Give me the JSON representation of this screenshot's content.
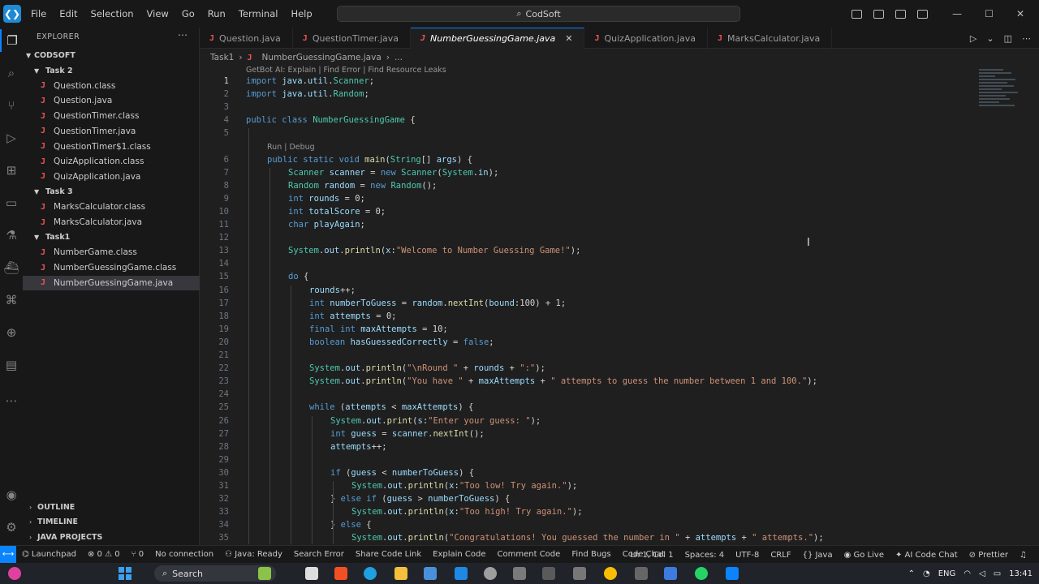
{
  "menu": [
    "File",
    "Edit",
    "Selection",
    "View",
    "Go",
    "Run",
    "Terminal",
    "Help"
  ],
  "search": {
    "text": "CodSoft"
  },
  "explorer": {
    "title": "EXPLORER",
    "root": "CODSOFT",
    "items": [
      {
        "label": "Task 2",
        "kind": "folder",
        "depth": 1
      },
      {
        "label": "Question.class",
        "kind": "class",
        "depth": 2
      },
      {
        "label": "Question.java",
        "kind": "java",
        "depth": 2
      },
      {
        "label": "QuestionTimer.class",
        "kind": "class",
        "depth": 2
      },
      {
        "label": "QuestionTimer.java",
        "kind": "java",
        "depth": 2
      },
      {
        "label": "QuestionTimer$1.class",
        "kind": "class",
        "depth": 2
      },
      {
        "label": "QuizApplication.class",
        "kind": "class",
        "depth": 2
      },
      {
        "label": "QuizApplication.java",
        "kind": "java",
        "depth": 2
      },
      {
        "label": "Task 3",
        "kind": "folder",
        "depth": 1
      },
      {
        "label": "MarksCalculator.class",
        "kind": "class",
        "depth": 2
      },
      {
        "label": "MarksCalculator.java",
        "kind": "java",
        "depth": 2
      },
      {
        "label": "Task1",
        "kind": "folder",
        "depth": 1
      },
      {
        "label": "NumberGame.class",
        "kind": "class",
        "depth": 2
      },
      {
        "label": "NumberGuessingGame.class",
        "kind": "class",
        "depth": 2
      },
      {
        "label": "NumberGuessingGame.java",
        "kind": "java",
        "depth": 2,
        "selected": true
      }
    ],
    "panels": [
      "OUTLINE",
      "TIMELINE",
      "JAVA PROJECTS"
    ]
  },
  "tabs": [
    {
      "label": "Question.java",
      "active": false
    },
    {
      "label": "QuestionTimer.java",
      "active": false
    },
    {
      "label": "NumberGuessingGame.java",
      "active": true
    },
    {
      "label": "QuizApplication.java",
      "active": false
    },
    {
      "label": "MarksCalculator.java",
      "active": false
    }
  ],
  "breadcrumb": [
    "Task1",
    "NumberGuessingGame.java",
    "..."
  ],
  "codelens": {
    "getbot": "GetBot AI: Explain | Find Error | Find Resource Leaks",
    "run": "Run | Debug"
  },
  "code": [
    {
      "n": 1,
      "text": "import java.util.Scanner;",
      "indent": 0
    },
    {
      "n": 2,
      "text": "import java.util.Random;",
      "indent": 0
    },
    {
      "n": 3,
      "text": "",
      "indent": 0
    },
    {
      "n": 4,
      "text": "public class NumberGuessingGame {",
      "indent": 0
    },
    {
      "n": 5,
      "text": "",
      "indent": 0
    },
    {
      "n": 6,
      "text": "public static void main(String[] args) {",
      "indent": 1
    },
    {
      "n": 7,
      "text": "Scanner scanner = new Scanner(System.in);",
      "indent": 2
    },
    {
      "n": 8,
      "text": "Random random = new Random();",
      "indent": 2
    },
    {
      "n": 9,
      "text": "int rounds = 0;",
      "indent": 2
    },
    {
      "n": 10,
      "text": "int totalScore = 0;",
      "indent": 2
    },
    {
      "n": 11,
      "text": "char playAgain;",
      "indent": 2
    },
    {
      "n": 12,
      "text": "",
      "indent": 0
    },
    {
      "n": 13,
      "text": "System.out.println(x:\"Welcome to Number Guessing Game!\");",
      "indent": 2
    },
    {
      "n": 14,
      "text": "",
      "indent": 0
    },
    {
      "n": 15,
      "text": "do {",
      "indent": 2
    },
    {
      "n": 16,
      "text": "rounds++;",
      "indent": 3
    },
    {
      "n": 17,
      "text": "int numberToGuess = random.nextInt(bound:100) + 1;",
      "indent": 3
    },
    {
      "n": 18,
      "text": "int attempts = 0;",
      "indent": 3
    },
    {
      "n": 19,
      "text": "final int maxAttempts = 10;",
      "indent": 3
    },
    {
      "n": 20,
      "text": "boolean hasGuessedCorrectly = false;",
      "indent": 3
    },
    {
      "n": 21,
      "text": "",
      "indent": 0
    },
    {
      "n": 22,
      "text": "System.out.println(\"\\nRound \" + rounds + \":\");",
      "indent": 3
    },
    {
      "n": 23,
      "text": "System.out.println(\"You have \" + maxAttempts + \" attempts to guess the number between 1 and 100.\");",
      "indent": 3
    },
    {
      "n": 24,
      "text": "",
      "indent": 0
    },
    {
      "n": 25,
      "text": "while (attempts < maxAttempts) {",
      "indent": 3
    },
    {
      "n": 26,
      "text": "System.out.print(s:\"Enter your guess: \");",
      "indent": 4
    },
    {
      "n": 27,
      "text": "int guess = scanner.nextInt();",
      "indent": 4
    },
    {
      "n": 28,
      "text": "attempts++;",
      "indent": 4
    },
    {
      "n": 29,
      "text": "",
      "indent": 0
    },
    {
      "n": 30,
      "text": "if (guess < numberToGuess) {",
      "indent": 4
    },
    {
      "n": 31,
      "text": "System.out.println(x:\"Too low! Try again.\");",
      "indent": 5
    },
    {
      "n": 32,
      "text": "} else if (guess > numberToGuess) {",
      "indent": 4
    },
    {
      "n": 33,
      "text": "System.out.println(x:\"Too high! Try again.\");",
      "indent": 5
    },
    {
      "n": 34,
      "text": "} else {",
      "indent": 4
    },
    {
      "n": 35,
      "text": "System.out.println(\"Congratulations! You guessed the number in \" + attempts + \" attempts.\");",
      "indent": 5
    }
  ],
  "status": {
    "launchpad": "Launchpad",
    "errors": "0",
    "warnings": "0",
    "ports": "0",
    "connection": "No connection",
    "java_ready": "Java: Ready",
    "items": [
      "Search Error",
      "Share Code Link",
      "Explain Code",
      "Comment Code",
      "Find Bugs",
      "Code Chat"
    ],
    "position": "Ln 1, Col 1",
    "spaces": "Spaces: 4",
    "encoding": "UTF-8",
    "eol": "CRLF",
    "language": "Java",
    "golive": "Go Live",
    "aichat": "AI Code Chat",
    "prettier": "Prettier"
  },
  "taskbar": {
    "search": "Search",
    "lang": "ENG",
    "time": "13:41"
  },
  "colors": {
    "accent": "#0a84ff",
    "keyword": "#569cd6",
    "type": "#4ec9b0",
    "string": "#ce9178",
    "variable": "#9cdcfe",
    "method": "#dcdcaa",
    "java_icon": "#f05454"
  }
}
